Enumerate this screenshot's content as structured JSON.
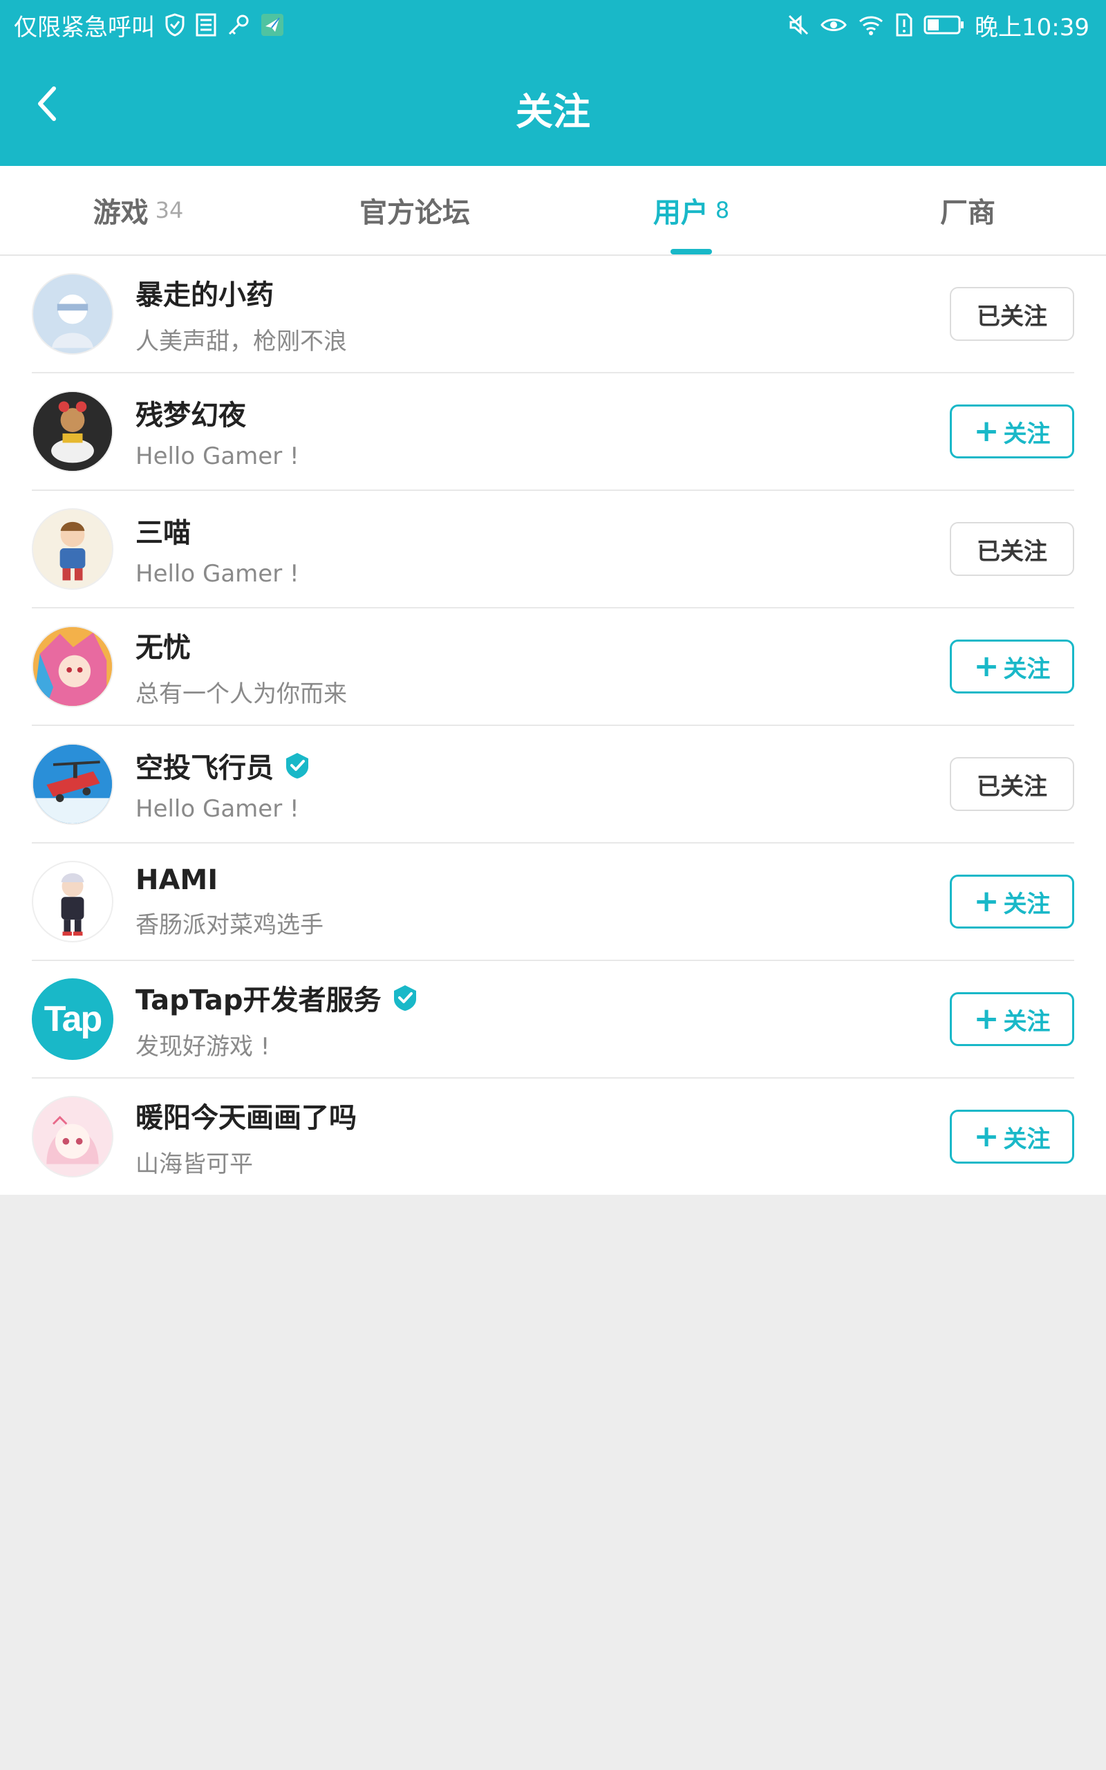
{
  "status_bar": {
    "left_text": "仅限紧急呼叫",
    "time": "晚上10:39"
  },
  "header": {
    "title": "关注",
    "back_icon": "chevron-left-icon"
  },
  "tabs": [
    {
      "label": "游戏",
      "count": "34",
      "active": false
    },
    {
      "label": "官方论坛",
      "count": "",
      "active": false
    },
    {
      "label": "用户",
      "count": "8",
      "active": true
    },
    {
      "label": "厂商",
      "count": "",
      "active": false
    }
  ],
  "users": [
    {
      "name": "暴走的小药",
      "bio": " 人美声甜，枪刚不浪",
      "verified": false,
      "followed": true,
      "button_label": "已关注",
      "avatar_color": "#cfe0f0"
    },
    {
      "name": "残梦幻夜",
      "bio": "Hello Gamer !",
      "verified": false,
      "followed": false,
      "button_label": "关注",
      "avatar_color": "#3a3a3a"
    },
    {
      "name": "三喵",
      "bio": "Hello Gamer !",
      "verified": false,
      "followed": true,
      "button_label": "已关注",
      "avatar_color": "#f6f0e2"
    },
    {
      "name": "无忧",
      "bio": "总有一个人为你而来",
      "verified": false,
      "followed": false,
      "button_label": "关注",
      "avatar_color": "#f3b14a"
    },
    {
      "name": "空投飞行员",
      "bio": "Hello Gamer !",
      "verified": true,
      "followed": true,
      "button_label": "已关注",
      "avatar_color": "#2a8fd8"
    },
    {
      "name": "HAMI",
      "bio": "香肠派对菜鸡选手",
      "verified": false,
      "followed": false,
      "button_label": "关注",
      "avatar_color": "#ffffff"
    },
    {
      "name": "TapTap开发者服务",
      "bio": "发现好游戏 !",
      "verified": true,
      "followed": false,
      "button_label": "关注",
      "avatar_color": "#19b8c8",
      "avatar_text": "Tap"
    },
    {
      "name": "暖阳今天画画了吗",
      "bio": "山海皆可平",
      "verified": false,
      "followed": false,
      "button_label": "关注",
      "avatar_color": "#fbe4ea"
    }
  ],
  "colors": {
    "accent": "#19b8c8",
    "background": "#ededed"
  }
}
